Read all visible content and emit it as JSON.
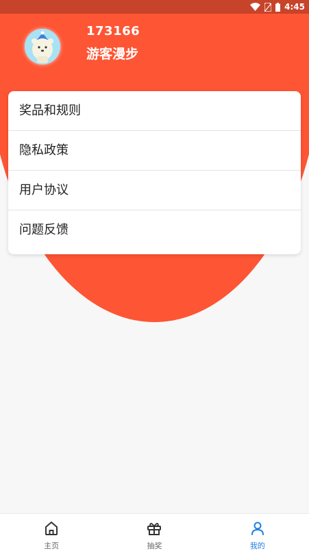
{
  "status_bar": {
    "time": "4:45"
  },
  "profile": {
    "user_id": "173166",
    "nickname": "游客漫步"
  },
  "menu": {
    "items": [
      {
        "label": "奖品和规则"
      },
      {
        "label": "隐私政策"
      },
      {
        "label": "用户协议"
      },
      {
        "label": "问题反馈"
      }
    ]
  },
  "tabbar": {
    "tabs": [
      {
        "label": "主页",
        "icon": "home-icon",
        "active": false
      },
      {
        "label": "抽奖",
        "icon": "gift-icon",
        "active": false
      },
      {
        "label": "我的",
        "icon": "person-icon",
        "active": true
      }
    ]
  },
  "colors": {
    "header": "#fe5534",
    "status_bar": "#c7432a",
    "active_tab": "#1e7fe0"
  }
}
